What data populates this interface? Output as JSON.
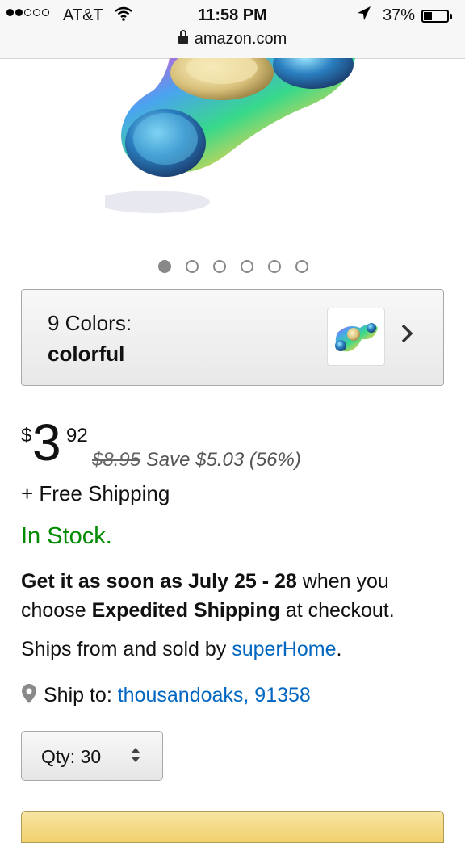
{
  "status_bar": {
    "carrier": "AT&T",
    "time": "11:58 PM",
    "battery_percent": "37%",
    "battery_level": 0.37,
    "url": "amazon.com",
    "icons": [
      "signal-dots-icon",
      "wifi-icon",
      "location-arrow-icon",
      "battery-icon",
      "lock-icon"
    ]
  },
  "gallery": {
    "image": "fidget-spinner-rainbow",
    "dots_total": 6,
    "active_index": 0
  },
  "variant": {
    "label": "9 Colors:",
    "value": "colorful"
  },
  "price": {
    "currency": "$",
    "whole": "3",
    "fraction": "92",
    "list_price": "$8.95",
    "savings": "Save $5.03 (56%)"
  },
  "shipping": "+ Free Shipping",
  "stock": "In Stock.",
  "delivery": {
    "bold_text": "Get it as soon as July 25 - 28",
    "text1": " when you choose ",
    "bold_method": "Expedited Shipping",
    "text2": " at checkout."
  },
  "seller": {
    "prefix": "Ships from and sold by ",
    "name": "superHome",
    "suffix": "."
  },
  "ship_to": {
    "label": "Ship to:",
    "location": "thousandoaks, 91358"
  },
  "quantity": {
    "label": "Qty:",
    "value": "30"
  },
  "colors": {
    "in_stock_green": "#008a00",
    "link_blue": "#0066c0",
    "cart_yellow": "#f1d16e"
  }
}
